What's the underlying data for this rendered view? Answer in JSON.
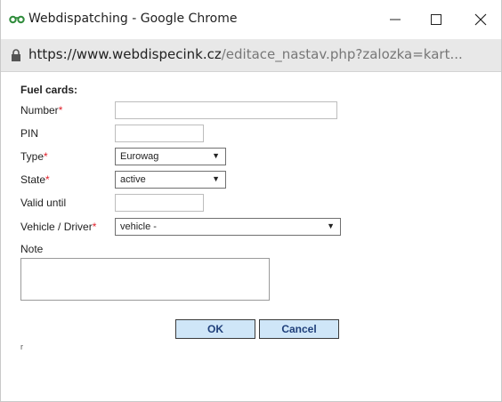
{
  "window": {
    "title": "Webdispatching - Google Chrome",
    "url_scheme_host": "https://www.webdispecink.cz",
    "url_path": "/editace_nastav.php?zalozka=kart..."
  },
  "form": {
    "heading": "Fuel cards:",
    "number_label": "Number",
    "number_value": "",
    "pin_label": "PIN",
    "pin_value": "",
    "type_label": "Type",
    "type_value": "Eurowag",
    "state_label": "State",
    "state_value": "active",
    "valid_until_label": "Valid until",
    "valid_until_value": "",
    "vehicle_driver_label": "Vehicle / Driver",
    "vehicle_driver_value": "vehicle -",
    "note_label": "Note",
    "note_value": "",
    "required_mark": "*",
    "ok_label": "OK",
    "cancel_label": "Cancel",
    "corner_mark": "r"
  },
  "colors": {
    "required": "#e0202a",
    "button_bg": "#cfe6f8",
    "button_text": "#1f3f7a",
    "address_bar_bg": "#e8e8e8"
  }
}
